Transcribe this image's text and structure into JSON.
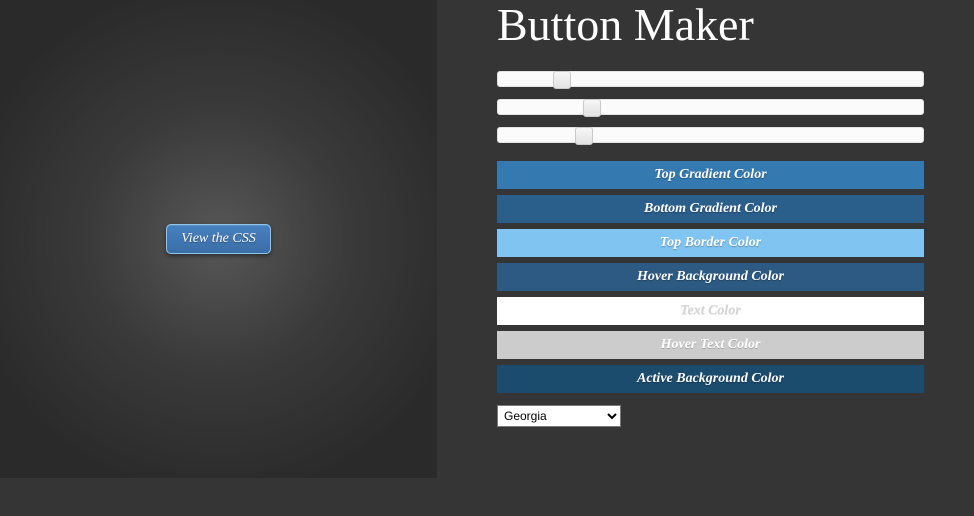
{
  "title": "Button Maker",
  "preview": {
    "label": "View the CSS"
  },
  "sliders": [
    {
      "pos_pct": 13
    },
    {
      "pos_pct": 20
    },
    {
      "pos_pct": 18
    }
  ],
  "color_buttons": [
    {
      "label": "Top Gradient Color"
    },
    {
      "label": "Bottom Gradient Color"
    },
    {
      "label": "Top Border Color"
    },
    {
      "label": "Hover Background Color"
    },
    {
      "label": "Text Color"
    },
    {
      "label": "Hover Text Color"
    },
    {
      "label": "Active Background Color"
    }
  ],
  "font_select": {
    "value": "Georgia"
  }
}
